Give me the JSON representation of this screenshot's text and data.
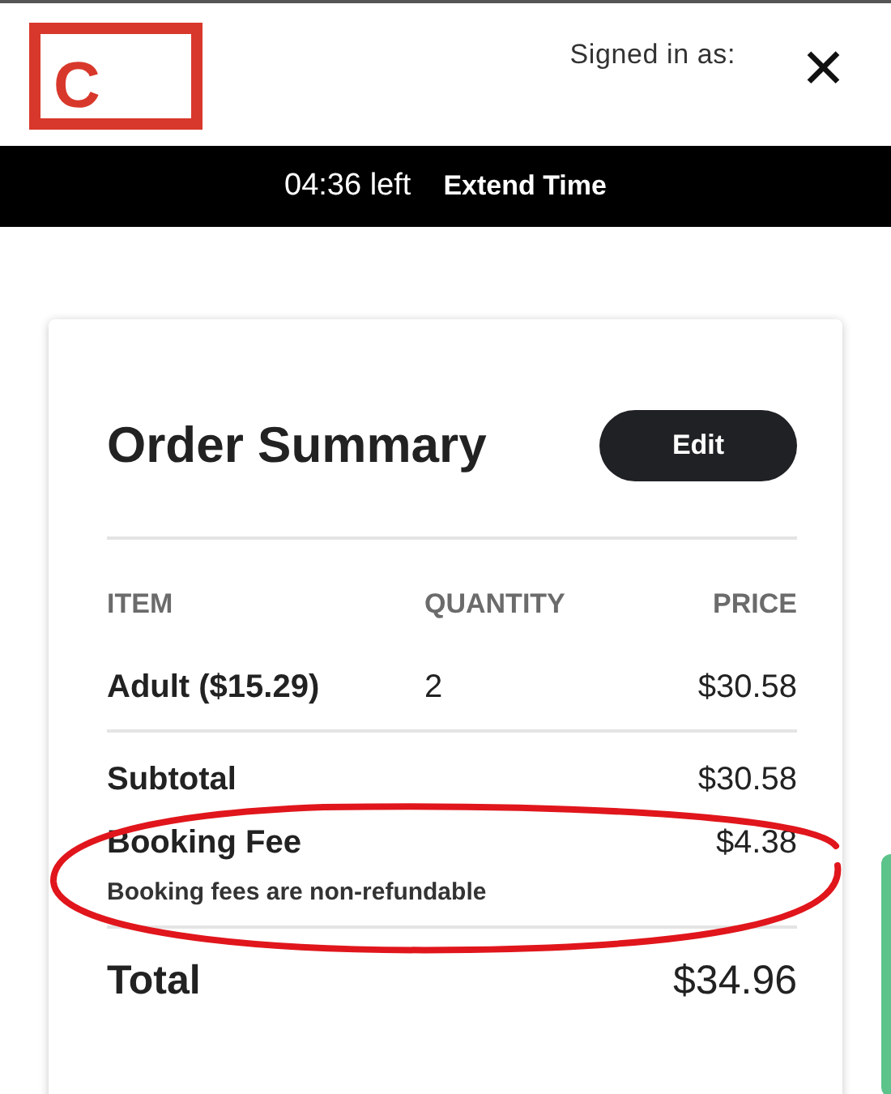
{
  "header": {
    "logo_letter": "C",
    "signed_in_label": "Signed in as:",
    "close_symbol": "✕"
  },
  "timer_bar": {
    "time_left": "04:36 left",
    "extend_link": "Extend Time"
  },
  "order_summary": {
    "title": "Order Summary",
    "edit_button": "Edit",
    "columns": [
      "ITEM",
      "QUANTITY",
      "PRICE"
    ],
    "items": [
      {
        "name": "Adult ($15.29)",
        "quantity": "2",
        "price": "$30.58"
      }
    ],
    "subtotal": {
      "label": "Subtotal",
      "amount": "$30.58"
    },
    "booking_fee": {
      "label": "Booking Fee",
      "amount": "$4.38",
      "note": "Booking fees are non-refundable",
      "circled": true
    },
    "total": {
      "label": "Total",
      "amount": "$34.96"
    }
  }
}
